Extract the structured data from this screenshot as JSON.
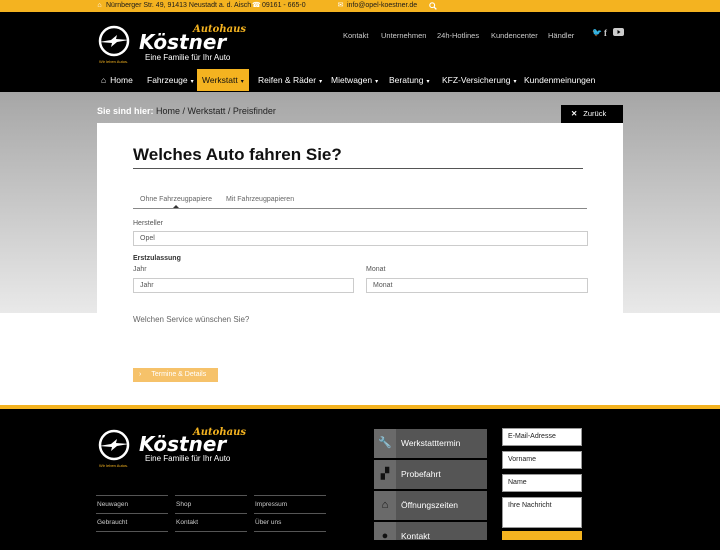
{
  "topbar": {
    "address": "Nürnberger Str. 49, 91413 Neustadt a. d. Aisch",
    "phone": "09161 - 665-0",
    "email": "info@opel-koestner.de"
  },
  "brand": {
    "script": "Autohaus",
    "name": "Köstner",
    "tagline": "Eine Familie für Ihr Auto",
    "opel_tagline": "Wir leben Autos."
  },
  "utility_nav": [
    "Kontakt",
    "Unternehmen",
    "24h-Hotlines",
    "Kundencenter",
    "Händler"
  ],
  "main_nav": [
    {
      "label": "Home",
      "icon": "home-icon"
    },
    {
      "label": "Fahrzeuge",
      "dropdown": true
    },
    {
      "label": "Werkstatt",
      "dropdown": true,
      "active": true
    },
    {
      "label": "Reifen & Räder",
      "dropdown": true
    },
    {
      "label": "Mietwagen",
      "dropdown": true
    },
    {
      "label": "Beratung",
      "dropdown": true
    },
    {
      "label": "KFZ-Versicherung",
      "dropdown": true
    },
    {
      "label": "Kundenmeinungen"
    }
  ],
  "breadcrumb": {
    "label": "Sie sind hier:",
    "path": "Home / Werkstatt / Preisfinder"
  },
  "back_button": "Zurück",
  "form": {
    "title": "Welches Auto fahren Sie?",
    "tabs": [
      "Ohne Fahrzeugpapiere",
      "Mit Fahrzeugpapieren"
    ],
    "manufacturer_label": "Hersteller",
    "manufacturer_value": "Opel",
    "registration_label": "Erstzulassung",
    "year_label": "Jahr",
    "year_value": "Jahr",
    "month_label": "Monat",
    "month_value": "Monat",
    "service_question": "Welchen Service wünschen Sie?",
    "submit_label": "Termine & Details"
  },
  "footer": {
    "links_col1": [
      "Neuwagen",
      "Gebraucht"
    ],
    "links_col2": [
      "Shop",
      "Kontakt"
    ],
    "links_col3": [
      "Impressum",
      "Über uns"
    ],
    "services": [
      {
        "label": "Werkstatttermin",
        "icon": "wrench-icon"
      },
      {
        "label": "Probefahrt",
        "icon": "car-seat-icon"
      },
      {
        "label": "Öffnungszeiten",
        "icon": "garage-icon"
      },
      {
        "label": "Kontakt",
        "icon": "map-pin-icon"
      }
    ],
    "contact_fields": [
      "E-Mail-Adresse",
      "Vorname",
      "Name",
      "Ihre Nachricht"
    ]
  },
  "colors": {
    "accent": "#f4b320",
    "dark": "#000000"
  }
}
